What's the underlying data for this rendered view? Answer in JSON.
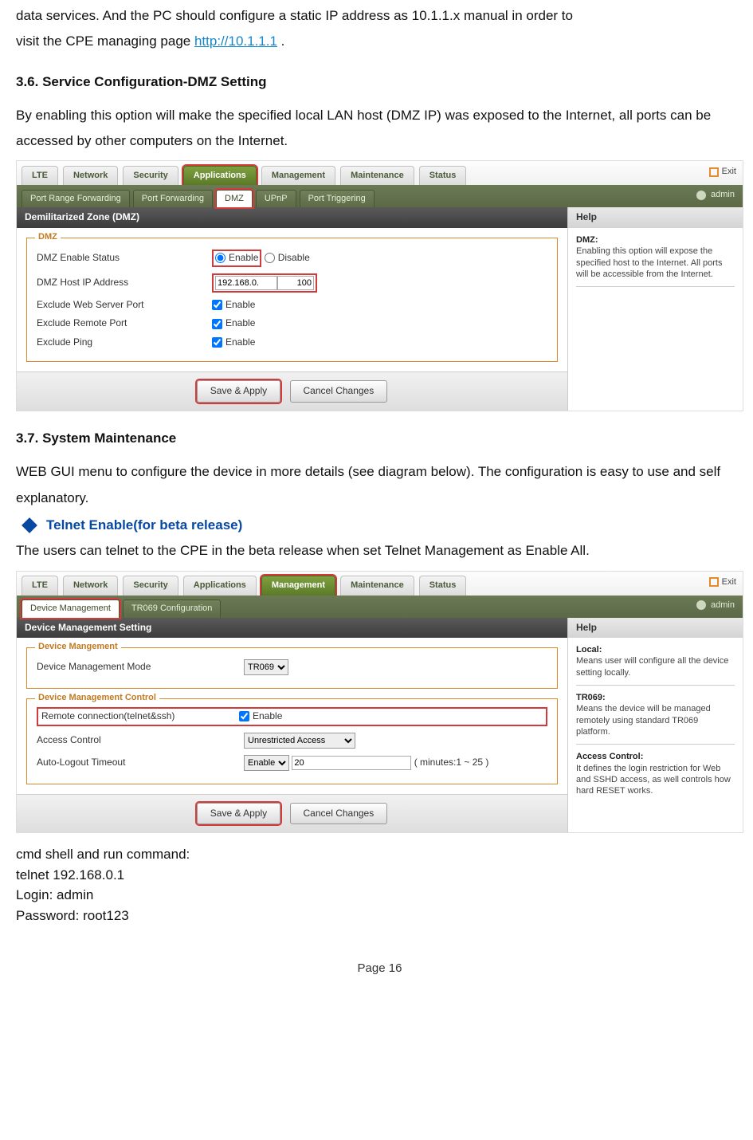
{
  "intro": {
    "p1a": "data services.  And the PC should configure a static IP address as 10.1.1.x manual in order to",
    "p1b": "visit the CPE managing page ",
    "link": "http://10.1.1.1",
    "p1c": " ."
  },
  "s36": {
    "heading": "3.6.    Service Configuration-DMZ Setting",
    "body": "By enabling this option will make the specified local LAN host (DMZ IP) was exposed to the Internet, all ports can be accessed by other computers on the Internet."
  },
  "shot1": {
    "tabs": [
      "LTE",
      "Network",
      "Security",
      "Applications",
      "Management",
      "Maintenance",
      "Status"
    ],
    "active_tab_index": 3,
    "exit": "Exit",
    "subtabs": [
      "Port Range Forwarding",
      "Port Forwarding",
      "DMZ",
      "UPnP",
      "Port Triggering"
    ],
    "active_subtab_index": 2,
    "admin": "admin",
    "panel_title": "Demilitarized Zone (DMZ)",
    "fieldset_legend": "DMZ",
    "rows": {
      "r0": "DMZ Enable Status",
      "r1": "DMZ Host IP Address",
      "r2": "Exclude Web Server Port",
      "r3": "Exclude Remote Port",
      "r4": "Exclude Ping"
    },
    "enable": "Enable",
    "disable": "Disable",
    "ip_prefix": "192.168.0.",
    "ip_suffix": "100",
    "save": "Save & Apply",
    "cancel": "Cancel Changes",
    "help_title": "Help",
    "help_h": "DMZ:",
    "help_body": "Enabling this option will expose the specified host to the Internet. All ports will be accessible from the Internet."
  },
  "s37": {
    "heading": "3.7.    System Maintenance",
    "body": "WEB GUI menu to configure the device in more details (see diagram below). The configuration is easy to use and self explanatory.",
    "bullet": "Telnet Enable(for beta release)",
    "body2": "The users  can telnet to the CPE  in the beta release when set Telnet Management as Enable All."
  },
  "shot2": {
    "tabs": [
      "LTE",
      "Network",
      "Security",
      "Applications",
      "Management",
      "Maintenance",
      "Status"
    ],
    "active_tab_index": 4,
    "exit": "Exit",
    "subtabs": [
      "Device Management",
      "TR069 Configuration"
    ],
    "active_subtab_index": 0,
    "admin": "admin",
    "panel_title": "Device Management Setting",
    "fs1_legend": "Device Mangement",
    "fs1_row": "Device Management Mode",
    "fs1_select": "TR069",
    "fs2_legend": "Device Management Control",
    "fs2_r0": "Remote connection(telnet&ssh)",
    "fs2_r0_enable": "Enable",
    "fs2_r1": "Access Control",
    "fs2_r1_val": "Unrestricted Access",
    "fs2_r2": "Auto-Logout Timeout",
    "fs2_r2_sel": "Enable",
    "fs2_r2_val": "20",
    "fs2_r2_note": "( minutes:1 ~ 25 )",
    "save": "Save & Apply",
    "cancel": "Cancel Changes",
    "help_title": "Help",
    "help_h1": "Local:",
    "help_b1": "Means user will configure all the device setting locally.",
    "help_h2": "TR069:",
    "help_b2": "Means the device will be managed remotely using standard TR069 platform.",
    "help_h3": "Access Control:",
    "help_b3": "It defines the login restriction for Web and SSHD access, as well controls how hard RESET works."
  },
  "tail": {
    "l1": "cmd shell and run command:",
    "l2": "telnet 192.168.0.1",
    "l3": "Login: admin",
    "l4": "Password: root123"
  },
  "footer": "Page 16"
}
